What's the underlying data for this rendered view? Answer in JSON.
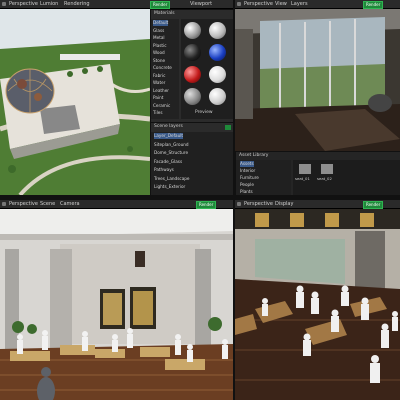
{
  "tl": {
    "tabs": [
      "Perspective",
      "Lumion",
      "Rendering"
    ],
    "render_button": "Render",
    "toolbar_right": "Viewport",
    "materials_panel": {
      "title": "Materials",
      "categories": [
        "Default",
        "Glass",
        "Metal",
        "Plastic",
        "Wood",
        "Stone",
        "Concrete",
        "Fabric",
        "Water",
        "Leather",
        "Paint",
        "Ceramic",
        "Tiles"
      ],
      "preview_label": "Preview"
    },
    "layers_panel": {
      "title": "Scene layers",
      "items": [
        "Layer_Default",
        "Siteplan_Ground",
        "Dome_Structure",
        "Facade_Glass",
        "Pathways",
        "Trees_Landscape",
        "Lights_Exterior"
      ]
    }
  },
  "tr": {
    "tabs": [
      "Perspective",
      "View",
      "Layers"
    ],
    "render_button": "Render",
    "explorer": {
      "title": "Asset Library",
      "folders": [
        "Assets",
        "Interior",
        "Furniture",
        "People",
        "Plants"
      ],
      "files": [
        "seat_01",
        "seat_02"
      ]
    }
  },
  "bl": {
    "tabs": [
      "Perspective",
      "Scene",
      "Camera"
    ],
    "render_button": "Render"
  },
  "br": {
    "tabs": [
      "Perspective",
      "Display"
    ],
    "render_button": "Render"
  },
  "colors": {
    "accent": "#1e8a3a",
    "ui_bg": "#2a2a2a",
    "panel_bg": "#2b2b2b"
  }
}
